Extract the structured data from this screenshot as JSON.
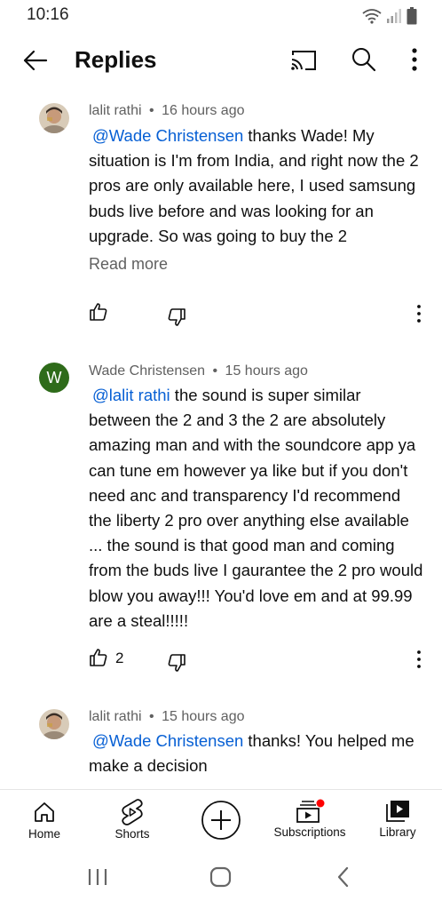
{
  "status_bar": {
    "time": "10:16"
  },
  "header": {
    "title": "Replies"
  },
  "comments": [
    {
      "author": "lalit rathi",
      "time": "16 hours ago",
      "mention": "@Wade Christensen",
      "text": " thanks Wade! My situation is I'm from India, and right now the 2 pros are only available here, I used samsung buds live before and was looking for an upgrade. So was going to buy the 2",
      "read_more": "Read more"
    },
    {
      "author": "Wade Christensen",
      "avatar_letter": "W",
      "time": "15 hours ago",
      "mention": "@lalit rathi",
      "text": " the sound is super similar between the 2 and 3 the 2 are absolutely amazing man and with the soundcore app ya can tune em however ya like but if you don't need anc and transparency I'd recommend the liberty 2 pro over anything else available ... the sound is that good man and coming from the buds live I gaurantee the 2 pro would blow you away!!! You'd love em and at 99.99 are a steal!!!!!",
      "likes": "2"
    },
    {
      "author": "lalit rathi",
      "time": "15 hours ago",
      "mention": "@Wade Christensen",
      "text": " thanks! You helped me make a decision"
    }
  ],
  "meta_separator": "•",
  "bottom_nav": {
    "home": "Home",
    "shorts": "Shorts",
    "subscriptions": "Subscriptions",
    "library": "Library"
  },
  "colors": {
    "mention": "#065fd4",
    "avatar_w": "#2e6b1a",
    "notification_dot": "#ff0000"
  }
}
